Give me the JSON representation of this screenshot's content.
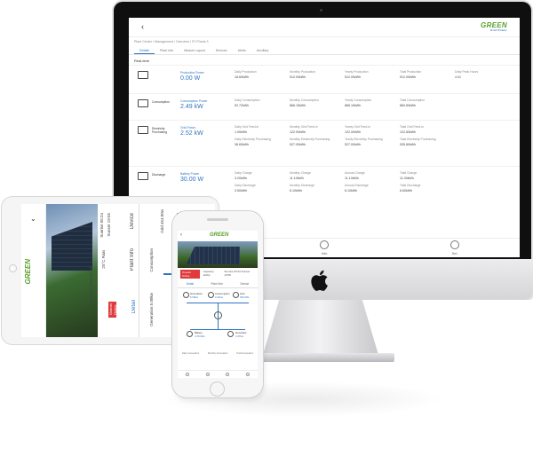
{
  "brand": {
    "name": "GREEN",
    "tagline": "Grid Power"
  },
  "desktop": {
    "back_glyph": "‹",
    "breadcrumb": "Plant Center \\ Management \\ Overview \\ ST-Plants 3",
    "tabs": [
      "Details",
      "Plant Info",
      "Module Layout",
      "Devices",
      "Alerts",
      "Ancillary"
    ],
    "section_title": "Real-time",
    "rows": [
      {
        "icon": "solar-panel-icon",
        "label": "",
        "main_title": "Production Power",
        "main_value": "0.00 W",
        "cells": [
          {
            "k": "Daily Production",
            "n": "18.60kWh"
          },
          {
            "k": "Monthly Production",
            "n": "512.00kWh"
          },
          {
            "k": "Yearly Production",
            "n": "512.00kWh"
          },
          {
            "k": "Total Production",
            "n": "512.00kWh"
          },
          {
            "k": "Daily Peak Hours",
            "n": "4.01"
          }
        ]
      },
      {
        "icon": "house-icon",
        "label": "Consumption",
        "main_title": "Consumption Power",
        "main_value": "2.49 kW",
        "cells": [
          {
            "k": "Daily Consumption",
            "n": "52.72kWh"
          },
          {
            "k": "Monthly Consumption",
            "n": "866.15kWh"
          },
          {
            "k": "Yearly Consumption",
            "n": "866.15kWh"
          },
          {
            "k": "Total Consumption",
            "n": "860.83kWh"
          }
        ]
      },
      {
        "icon": "grid-tower-icon",
        "label": "Electricity Purchasing",
        "main_title": "Grid Power",
        "main_value": "2.52 kW",
        "cells": [
          {
            "k": "Daily Grid Feed-in",
            "n": "1.00kWh"
          },
          {
            "k": "Monthly Grid Feed-in",
            "n": "122.00kWh"
          },
          {
            "k": "Yearly Grid Feed-in",
            "n": "122.00kWh"
          },
          {
            "k": "Total Grid Feed-in",
            "n": "122.83kWh"
          },
          {
            "k": "",
            "n": ""
          },
          {
            "k": "Daily Electricity Purchasing",
            "n": "38.60kWh"
          },
          {
            "k": "Monthly Electricity Purchasing",
            "n": "527.00kWh"
          },
          {
            "k": "Yearly Electricity Purchasing",
            "n": "527.00kWh"
          },
          {
            "k": "Total Electricity Purchasing",
            "n": "535.80kWh"
          }
        ]
      },
      {
        "icon": "battery-icon",
        "label": "Discharge",
        "main_title": "Battery Power",
        "main_value": "30.00 W",
        "cells": [
          {
            "k": "Daily Charge",
            "n": "3.20kWh"
          },
          {
            "k": "Monthly Charge",
            "n": "11.10kWh"
          },
          {
            "k": "Annual Charge",
            "n": "11.10kWh"
          },
          {
            "k": "Total Charge",
            "n": "11.00kWh"
          },
          {
            "k": "",
            "n": ""
          },
          {
            "k": "Daily Discharge",
            "n": "3.50kWh"
          },
          {
            "k": "Monthly Discharge",
            "n": "6.10kWh"
          },
          {
            "k": "Annual Discharge",
            "n": "6.10kWh"
          },
          {
            "k": "Total Discharge",
            "n": "6.60kWh"
          }
        ]
      }
    ],
    "nav": [
      "Data",
      "Info",
      "Set"
    ]
  },
  "tablet": {
    "text_updated": "Updated: 2023.07.06",
    "text_sunrise": "Sunrise 05:24",
    "text_sunset": "Sunset 19:55",
    "text_weather": "25°C Rain",
    "status": "Overall Online",
    "text_plant_info": "Plant Info",
    "text_device": "Device",
    "tab_detail": "Detail",
    "text_generation": "Generation 5.08kw",
    "text_grid": "Grid 454.00w",
    "text_consumption": "Consumption"
  },
  "phone": {
    "back_glyph": "‹",
    "status": "Overall Online",
    "capacity": "Capacity: 2kWp",
    "sun": "Sunrise 05:24 Sunset 19:55",
    "tabs": [
      "Detail",
      "Plant Info",
      "Device"
    ],
    "nodes": {
      "generation": "Generation",
      "generation_val": "5.09kw",
      "consumption": "Consumption",
      "consumption_val": "0.41kw",
      "grid": "Grid",
      "grid_val": "454.00w",
      "battery": "Battery",
      "battery_val": "-479.00w",
      "generator": "Generator",
      "generator_val": "4.37kw"
    },
    "stats": [
      "Daily Generation",
      "Monthly Generation",
      "Total Generation"
    ]
  }
}
